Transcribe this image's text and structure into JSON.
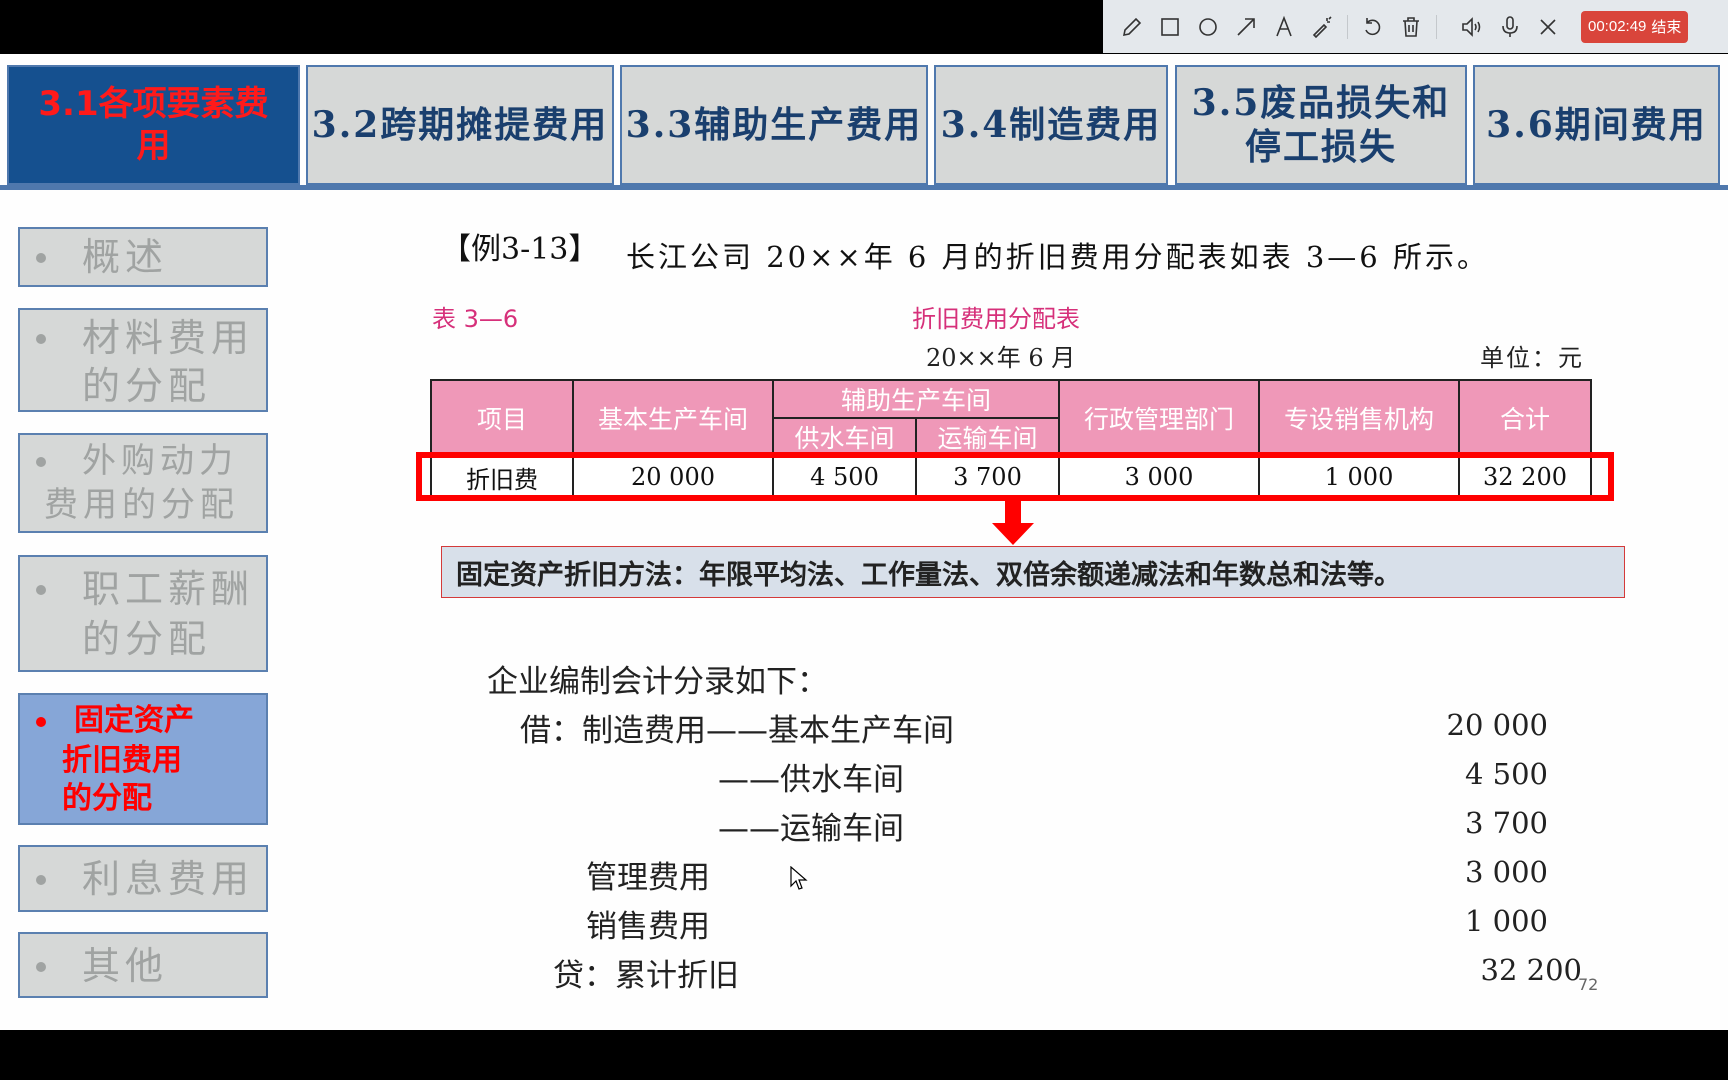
{
  "toolbar": {
    "tools": [
      "pencil-icon",
      "rectangle-icon",
      "circle-icon",
      "arrow-icon",
      "text-icon",
      "magic-wand-icon",
      "undo-icon",
      "trash-icon",
      "speaker-icon",
      "microphone-icon",
      "close-icon"
    ],
    "timer": "00:02:49",
    "end_label": "结束"
  },
  "tabs": [
    {
      "label": "3.1各项要素费用",
      "active": true
    },
    {
      "label": "3.2跨期摊提费用",
      "active": false
    },
    {
      "label": "3.3辅助生产费用",
      "active": false
    },
    {
      "label": "3.4制造费用",
      "active": false
    },
    {
      "label": "3.5废品损失和停工损失",
      "line1": "3.5废品损失和",
      "line2": "停工损失",
      "active": false
    },
    {
      "label": "3.6期间费用",
      "active": false
    }
  ],
  "sidebar": {
    "items": [
      {
        "line1": "概述",
        "line2": "",
        "active": false
      },
      {
        "line1": "材料费用",
        "line2": "的分配",
        "active": false
      },
      {
        "line1": "外购动力",
        "line2": "费用的分配",
        "active": false
      },
      {
        "line1": "职工薪酬",
        "line2": "的分配",
        "active": false
      },
      {
        "line1": "固定资产",
        "line2": "折旧费用",
        "line3": "的分配",
        "active": true
      },
      {
        "line1": "利息费用",
        "line2": "",
        "active": false
      },
      {
        "line1": "其他",
        "line2": "",
        "active": false
      }
    ]
  },
  "content": {
    "example_tag": "【例3-13】",
    "example_text": "长江公司 20××年 6 月的折旧费用分配表如表 3—6 所示。",
    "table_label": "表 3—6",
    "table_title": "折旧费用分配表",
    "table_date": "20××年 6 月",
    "table_unit": "单位：元",
    "table": {
      "headers": {
        "item": "项目",
        "basic": "基本生产车间",
        "aux_group": "辅助生产车间",
        "water": "供水车间",
        "transport": "运输车间",
        "admin": "行政管理部门",
        "sales": "专设销售机构",
        "total": "合计"
      },
      "row": {
        "item": "折旧费",
        "basic": "20 000",
        "water": "4 500",
        "transport": "3 700",
        "admin": "3 000",
        "sales": "1 000",
        "total": "32 200"
      }
    },
    "callout": "固定资产折旧方法：年限平均法、工作量法、双倍余额递减法和年数总和法等。",
    "journal": {
      "intro": "企业编制会计分录如下：",
      "entries": [
        {
          "text": "借：制造费用——基本生产车间",
          "amount": "20 000"
        },
        {
          "text": "——供水车间",
          "amount": "4 500"
        },
        {
          "text": "——运输车间",
          "amount": "3 700"
        },
        {
          "text": "管理费用",
          "amount": "3 000"
        },
        {
          "text": "销售费用",
          "amount": "1 000"
        },
        {
          "text": "贷：累计折旧",
          "amount": "32 200"
        }
      ]
    },
    "page_number": "72"
  },
  "colors": {
    "tab_active_bg": "#15508f",
    "tab_active_text": "#ff1a1a",
    "tab_text": "#1a3f6e",
    "table_header_bg": "#ef98b8",
    "highlight_red": "#ff0000",
    "record_button": "#d9453b"
  }
}
